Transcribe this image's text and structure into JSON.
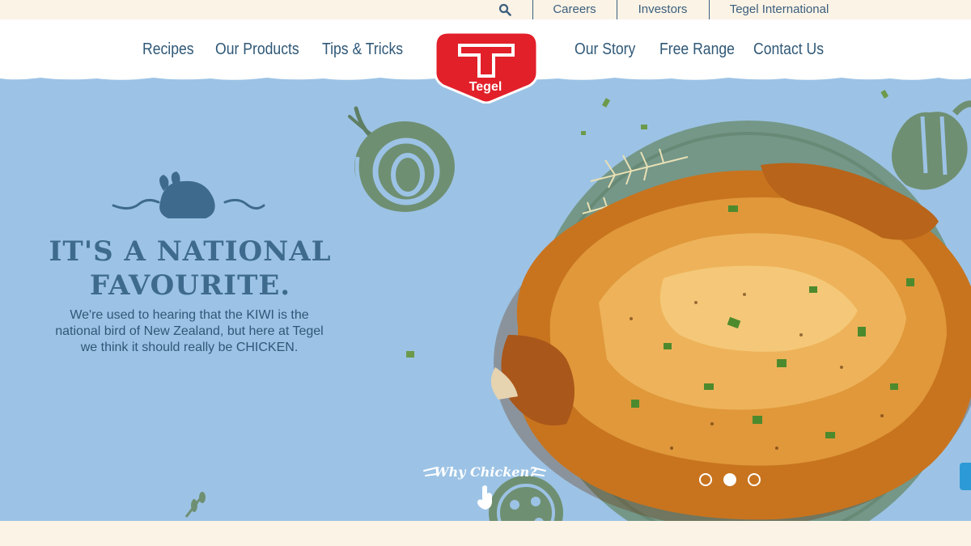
{
  "utility": {
    "search_icon": "search-icon",
    "links": [
      "Careers",
      "Investors",
      "Tegel International"
    ]
  },
  "nav": {
    "left": [
      "Recipes",
      "Our Products",
      "Tips & Tricks"
    ],
    "right": [
      "Our Story",
      "Free Range",
      "Contact Us"
    ]
  },
  "logo": {
    "text": "Tegel"
  },
  "hero": {
    "headline_line1": "IT'S A NATIONAL",
    "headline_line2": "FAVOURITE.",
    "body": "We're used to hearing that the KIWI is the national bird of New Zealand, but here at Tegel we think it should really be CHICKEN.",
    "cta": "Why Chicken?",
    "slides": 3,
    "active_slide": 2
  },
  "colors": {
    "brand_red": "#e2202a",
    "nav_blue": "#2f5877",
    "hero_bg": "#9cc3e5",
    "cream": "#fbf3e6"
  }
}
